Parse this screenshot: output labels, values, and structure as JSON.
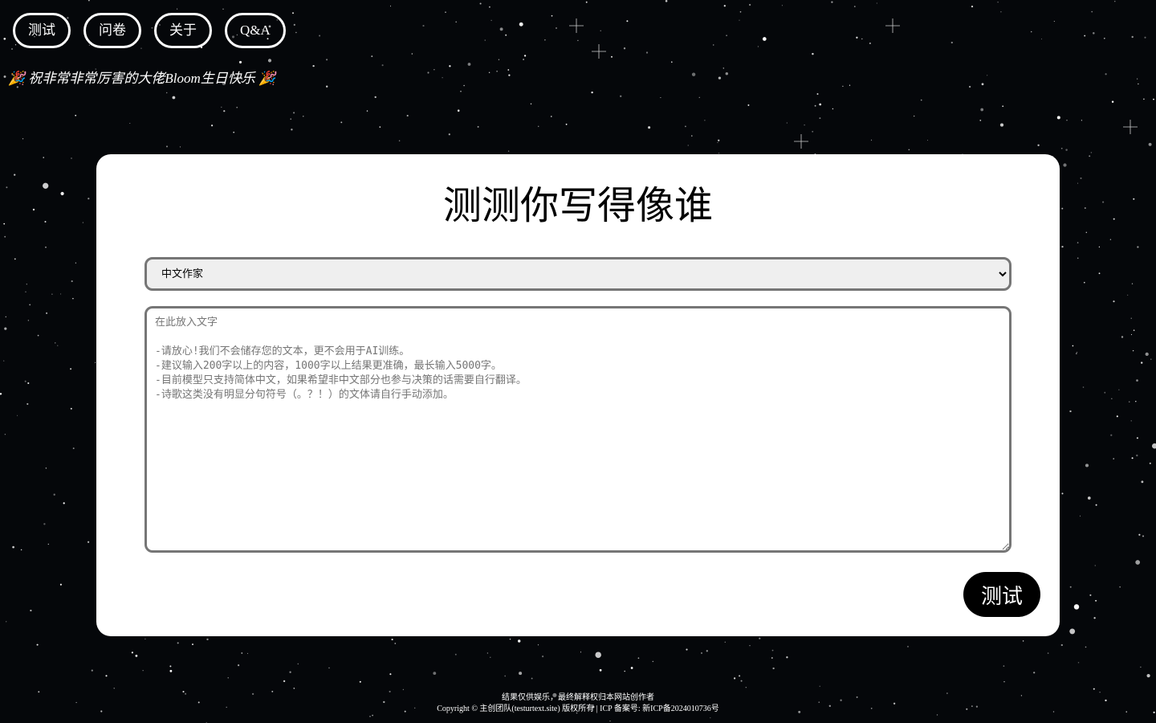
{
  "nav": {
    "items": [
      {
        "label": "测试"
      },
      {
        "label": "问卷"
      },
      {
        "label": "关于"
      },
      {
        "label": "Q&A"
      }
    ]
  },
  "banner": {
    "text": "🎉 祝非常非常厉害的大佬Bloom生日快乐 🎉"
  },
  "main": {
    "title": "测测你写得像谁",
    "writer_select": {
      "selected": "中文作家"
    },
    "text_input": {
      "value": "",
      "placeholder": "在此放入文字\n\n-请放心!我们不会储存您的文本，更不会用于AI训练。\n-建议输入200字以上的内容，1000字以上结果更准确，最长输入5000字。\n-目前模型只支持简体中文，如果希望非中文部分也参与决策的话需要自行翻译。\n-诗歌这类没有明显分句符号（。？！）的文体请自行手动添加。"
    },
    "submit_label": "测试"
  },
  "footer": {
    "disclaimer": "结果仅供娱乐，最终解释权归本网站创作者",
    "copyright": "Copyright © 主创团队(testurtext.site) 版权所有 | ICP 备案号: 新ICP备2024010736号"
  },
  "colors": {
    "background": "#05070a",
    "card": "#ffffff",
    "button": "#000000",
    "field_border": "#767676"
  }
}
